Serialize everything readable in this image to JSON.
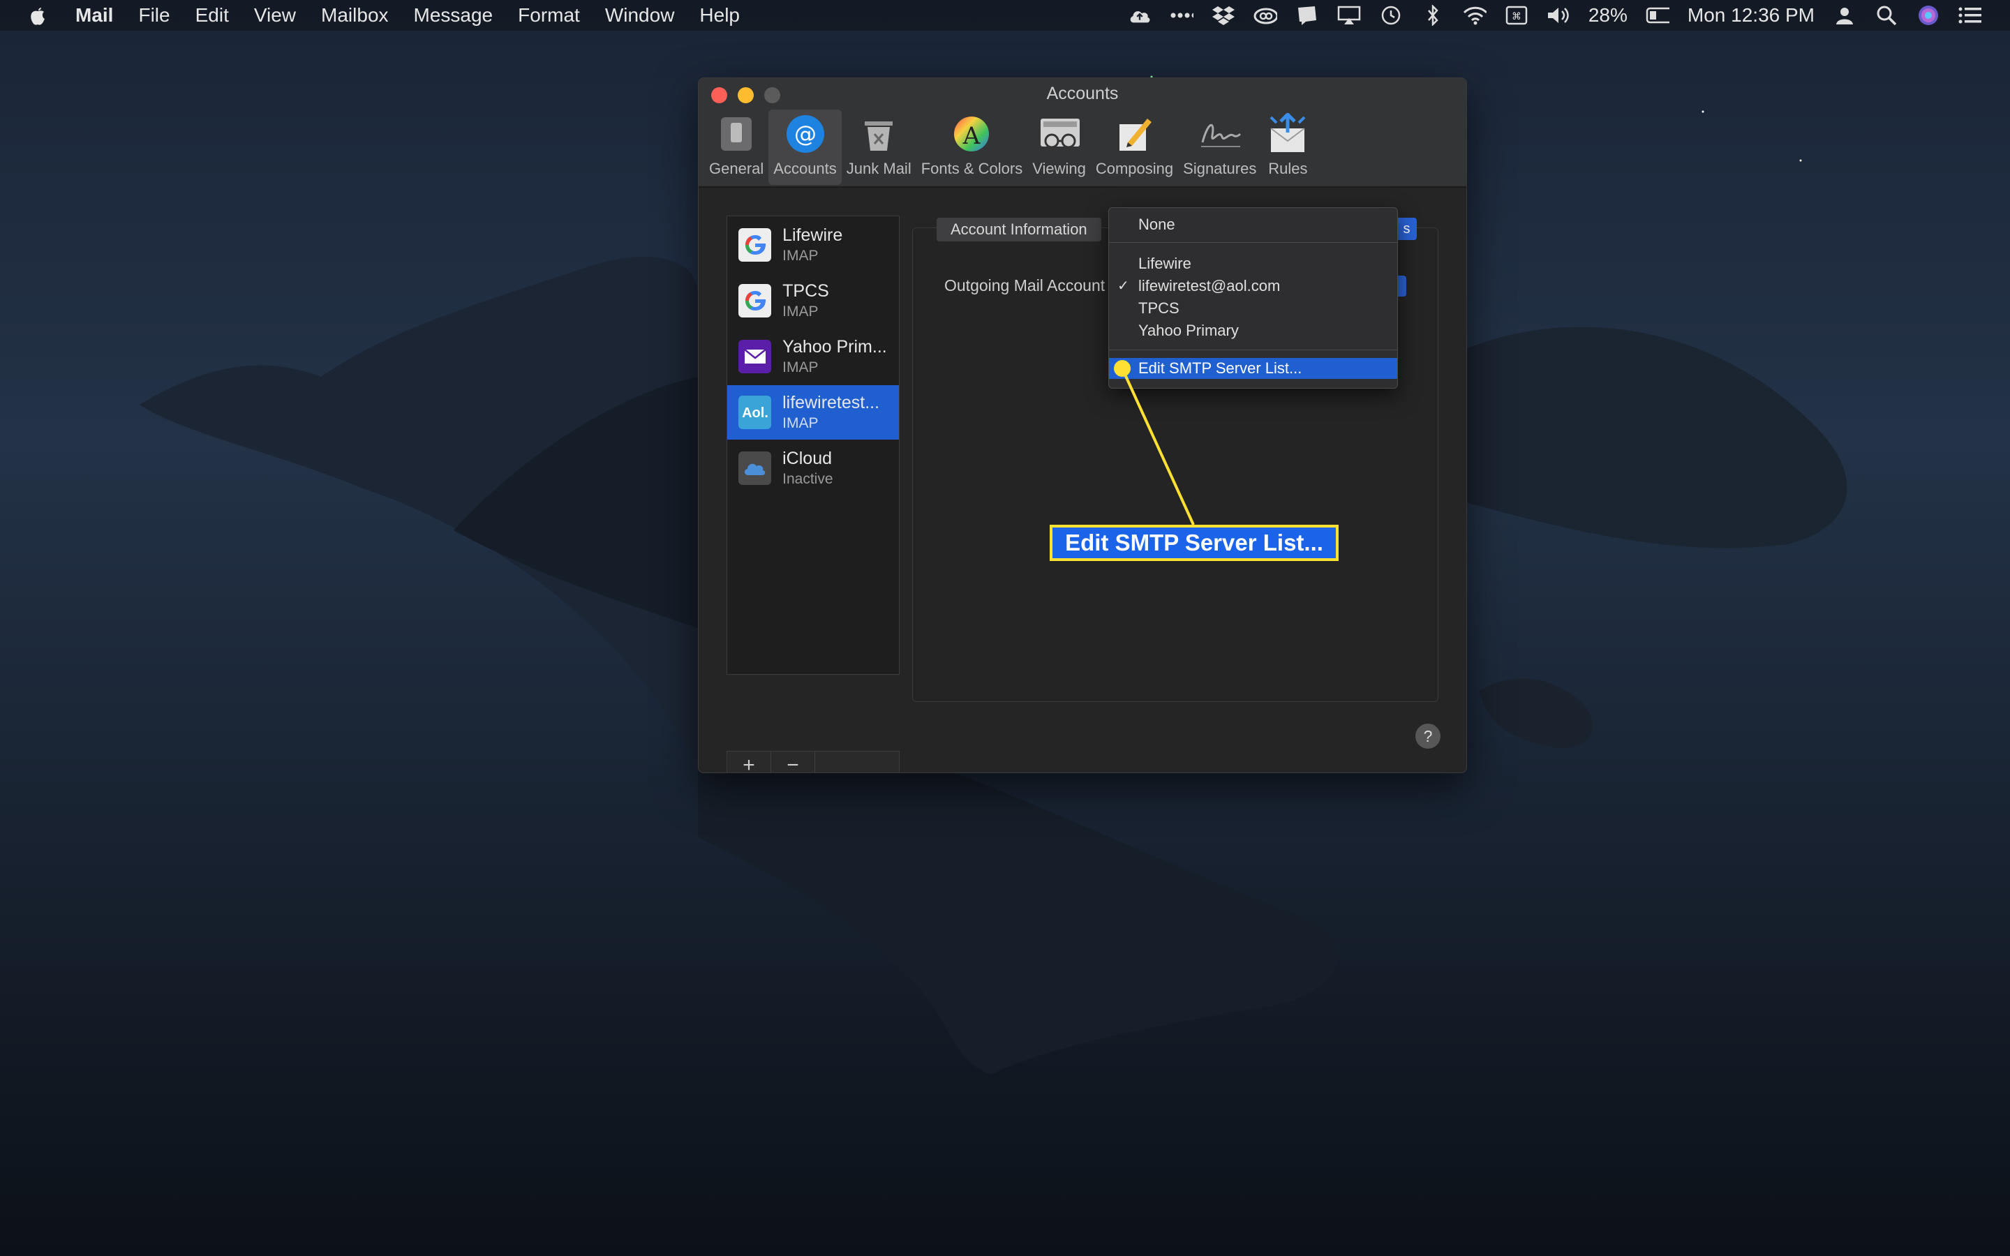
{
  "menubar": {
    "app": "Mail",
    "items": [
      "File",
      "Edit",
      "View",
      "Mailbox",
      "Message",
      "Format",
      "Window",
      "Help"
    ],
    "battery": "28%",
    "clock": "Mon 12:36 PM"
  },
  "window": {
    "title": "Accounts",
    "toolbar": [
      {
        "label": "General",
        "icon": "general-icon"
      },
      {
        "label": "Accounts",
        "icon": "at-icon"
      },
      {
        "label": "Junk Mail",
        "icon": "trash-icon"
      },
      {
        "label": "Fonts & Colors",
        "icon": "color-wheel-icon"
      },
      {
        "label": "Viewing",
        "icon": "glasses-icon"
      },
      {
        "label": "Composing",
        "icon": "pencil-icon"
      },
      {
        "label": "Signatures",
        "icon": "signature-icon"
      },
      {
        "label": "Rules",
        "icon": "rules-icon"
      }
    ]
  },
  "accounts": [
    {
      "name": "Lifewire",
      "type": "IMAP",
      "icon": "google-icon"
    },
    {
      "name": "TPCS",
      "type": "IMAP",
      "icon": "google-icon"
    },
    {
      "name": "Yahoo Prim...",
      "type": "IMAP",
      "icon": "yahoo-mail-icon"
    },
    {
      "name": "lifewiretest...",
      "type": "IMAP",
      "icon": "aol-icon",
      "selected": true
    },
    {
      "name": "iCloud",
      "type": "Inactive",
      "icon": "icloud-icon"
    }
  ],
  "list_controls": {
    "add": "+",
    "remove": "−"
  },
  "panel": {
    "tab_account_info": "Account Information",
    "tab_partial": "s",
    "outgoing_label": "Outgoing Mail Account"
  },
  "dropdown": {
    "none": "None",
    "options": [
      "Lifewire",
      "lifewiretest@aol.com",
      "TPCS",
      "Yahoo Primary"
    ],
    "checked": "lifewiretest@aol.com",
    "check_mark": "✓",
    "edit": "Edit SMTP Server List..."
  },
  "annotation": {
    "text": "Edit SMTP Server List...",
    "color": "#ffe033"
  },
  "help": "?"
}
